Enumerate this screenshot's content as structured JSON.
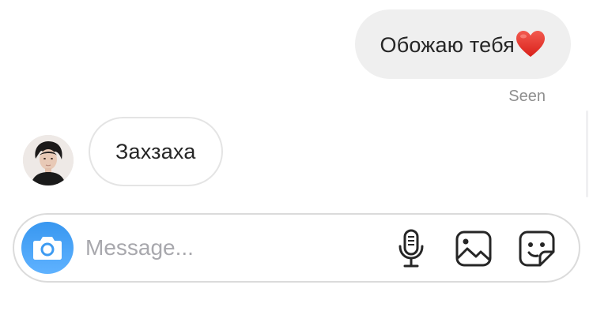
{
  "thread": {
    "sent_message": {
      "text": "Обожаю тебя",
      "emoji": "heart-icon",
      "status": "Seen"
    },
    "received_message": {
      "text": "Захзаха",
      "sender_avatar": "avatar"
    }
  },
  "composer": {
    "placeholder": "Message...",
    "value": "",
    "icons": {
      "camera": "camera-icon",
      "mic": "microphone-icon",
      "gallery": "gallery-icon",
      "sticker": "sticker-icon"
    }
  },
  "colors": {
    "sent_bubble": "#efefef",
    "received_border": "#e4e4e4",
    "accent_blue": "#3897f0",
    "heart_red": "#e53935",
    "text": "#262626",
    "muted": "#8e8e8e"
  }
}
